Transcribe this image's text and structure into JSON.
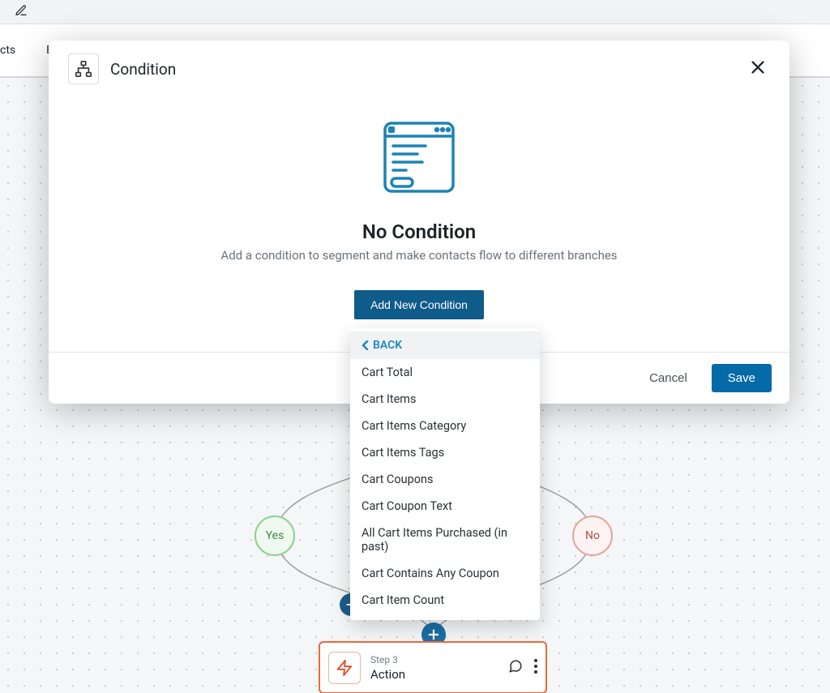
{
  "topTabs": {
    "tab1_suffix": "cts",
    "tab2_prefix": "En"
  },
  "modal": {
    "title": "Condition",
    "empty_title": "No Condition",
    "empty_subtitle": "Add a condition to segment and make contacts flow to different branches",
    "add_button_label": "Add New Condition",
    "cancel_label": "Cancel",
    "save_label": "Save"
  },
  "dropdown": {
    "back_label": "BACK",
    "items": [
      "Cart Total",
      "Cart Items",
      "Cart Items Category",
      "Cart Items Tags",
      "Cart Coupons",
      "Cart Coupon Text",
      "All Cart Items Purchased (in past)",
      "Cart Contains Any Coupon",
      "Cart Item Count"
    ]
  },
  "canvas": {
    "yes_label": "Yes",
    "no_label": "No",
    "action": {
      "step_label": "Step 3",
      "title": "Action"
    }
  },
  "colors": {
    "primary": "#0f5b8a",
    "accent": "#056aa8",
    "action_border": "#ea6a3a"
  }
}
